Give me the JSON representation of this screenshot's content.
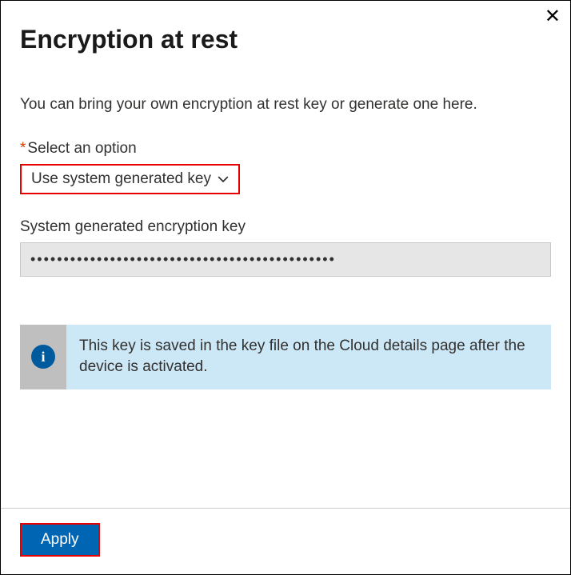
{
  "header": {
    "title": "Encryption at rest"
  },
  "description": "You can bring your own encryption at rest key or generate one here.",
  "option": {
    "required_mark": "*",
    "label": "Select an option",
    "selected": "Use system generated key"
  },
  "key": {
    "label": "System generated encryption key",
    "value": "••••••••••••••••••••••••••••••••••••••••••••••"
  },
  "info": {
    "icon_letter": "i",
    "text": "This key is saved in the key file on the Cloud details page after the device is activated."
  },
  "footer": {
    "apply_label": "Apply"
  }
}
